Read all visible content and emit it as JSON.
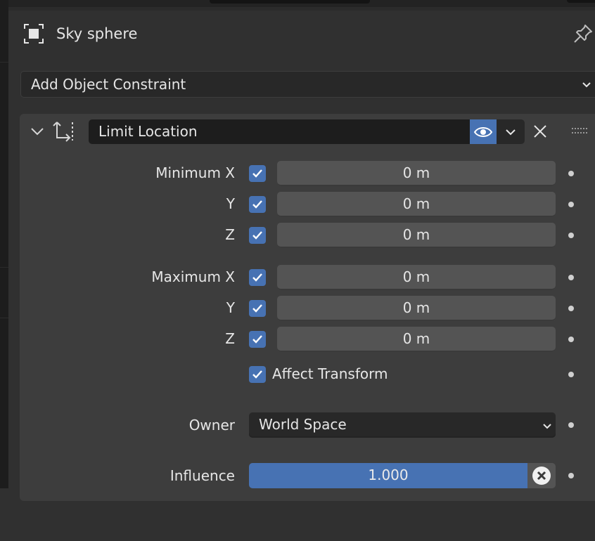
{
  "header": {
    "object_name": "Sky sphere",
    "object_icon": "object-data-icon",
    "pin_icon": "pin-icon"
  },
  "add_constraint": {
    "label": "Add Object Constraint"
  },
  "constraint": {
    "name": "Limit Location",
    "type_icon": "limit-location-icon",
    "minimum": {
      "label": "Minimum X",
      "rows": [
        {
          "axis": "Minimum X",
          "enabled": true,
          "value": "0 m"
        },
        {
          "axis": "Y",
          "enabled": true,
          "value": "0 m"
        },
        {
          "axis": "Z",
          "enabled": true,
          "value": "0 m"
        }
      ]
    },
    "maximum": {
      "label": "Maximum X",
      "rows": [
        {
          "axis": "Maximum X",
          "enabled": true,
          "value": "0 m"
        },
        {
          "axis": "Y",
          "enabled": true,
          "value": "0 m"
        },
        {
          "axis": "Z",
          "enabled": true,
          "value": "0 m"
        }
      ]
    },
    "affect_transform": {
      "label": "Affect Transform",
      "checked": true
    },
    "owner": {
      "label": "Owner",
      "value": "World Space"
    },
    "influence": {
      "label": "Influence",
      "value": "1.000",
      "fraction": 1.0
    }
  },
  "colors": {
    "accent": "#4772b3",
    "panel": "#3d3d3d",
    "background": "#303030",
    "field": "#545454"
  }
}
